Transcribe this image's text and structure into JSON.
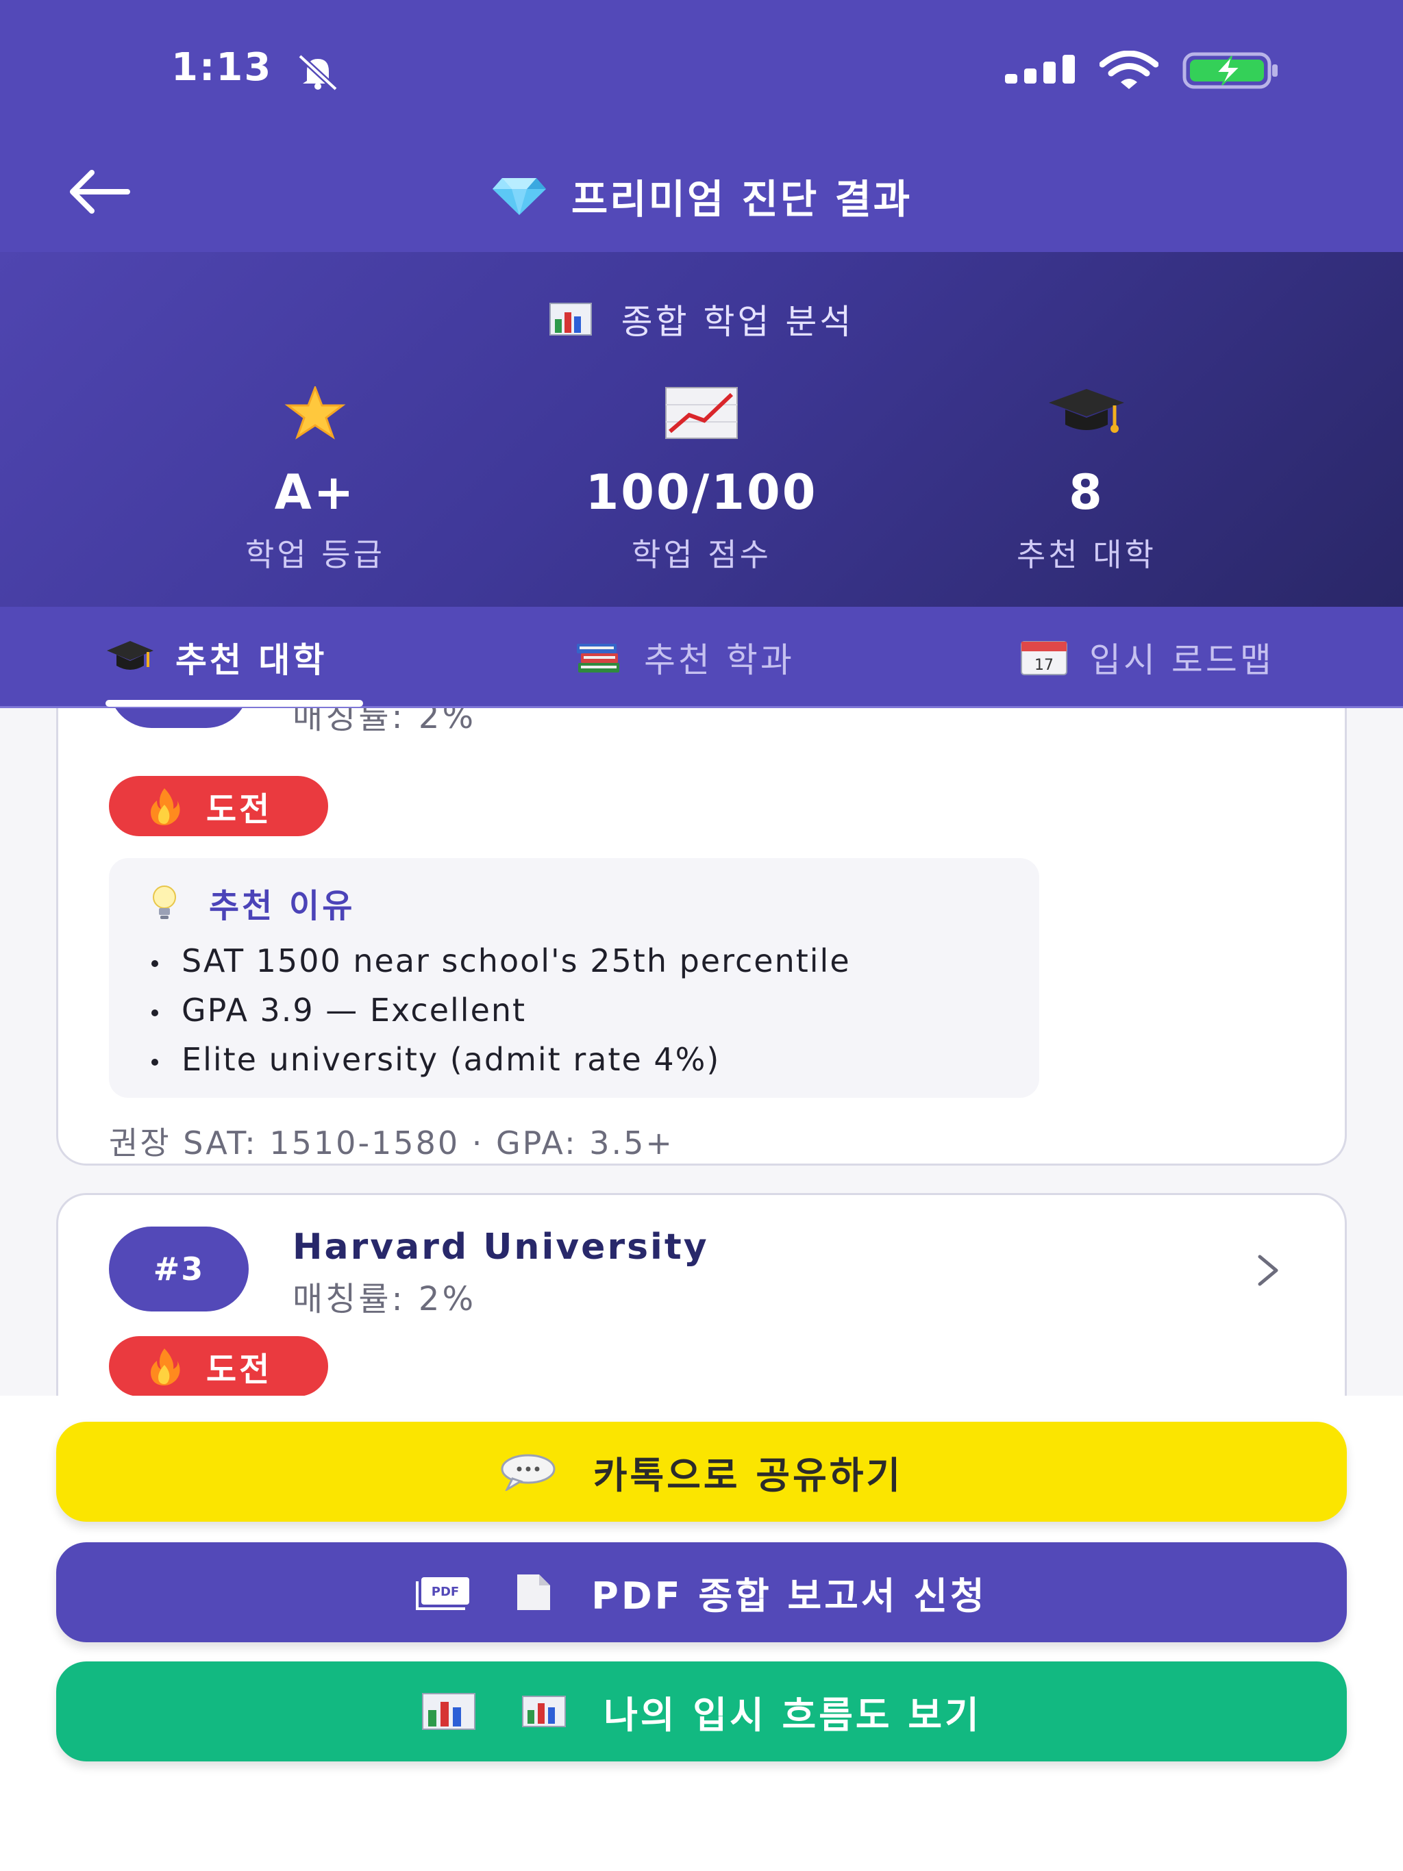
{
  "status_bar": {
    "time": "1:13"
  },
  "header": {
    "title": "프리미엄 진단 결과"
  },
  "summary": {
    "title": "종합 학업 분석",
    "stats": [
      {
        "icon": "star-icon",
        "value": "A+",
        "label": "학업 등급"
      },
      {
        "icon": "chart-increasing-icon",
        "value": "100/100",
        "label": "학업 점수"
      },
      {
        "icon": "graduation-cap-icon",
        "value": "8",
        "label": "추천 대학"
      }
    ]
  },
  "tabs": [
    {
      "icon": "graduation-cap-icon",
      "label": "추천 대학",
      "active": true
    },
    {
      "icon": "books-icon",
      "label": "추천 학과",
      "active": false
    },
    {
      "icon": "calendar-icon",
      "label": "입시 로드맵",
      "active": false
    }
  ],
  "cards": [
    {
      "rank": "",
      "name": "",
      "match": "매칭률: 2%",
      "badge": "도전",
      "reason_title": "추천 이유",
      "reasons": [
        "SAT 1500 near school's 25th percentile",
        "GPA 3.9 — Excellent",
        "Elite university (admit rate 4%)"
      ],
      "requirements": "권장 SAT: 1510-1580 · GPA: 3.5+"
    },
    {
      "rank": "#3",
      "name": "Harvard University",
      "match": "매칭률: 2%",
      "badge": "도전"
    }
  ],
  "actions": {
    "share_kakao": "카톡으로 공유하기",
    "pdf_report": "PDF 종합 보고서 신청",
    "view_flow": "나의 입시 흐름도 보기"
  },
  "colors": {
    "primary": "#5349b8",
    "challenge_badge": "#ea3a3f",
    "kakao": "#fbe500",
    "success": "#12b981"
  }
}
